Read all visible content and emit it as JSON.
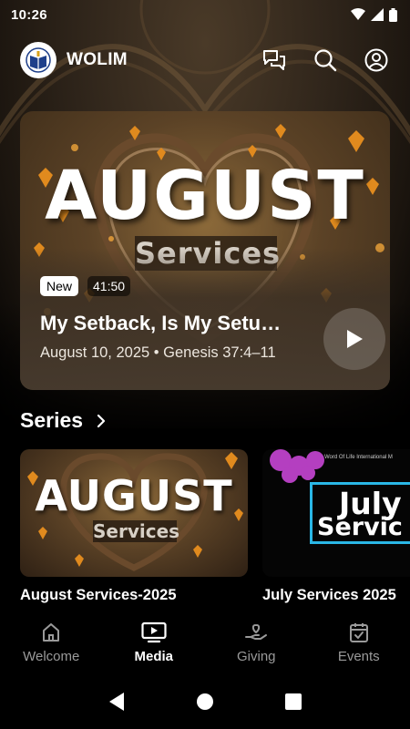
{
  "status_bar": {
    "time": "10:26"
  },
  "header": {
    "app_name": "WOLIM"
  },
  "hero": {
    "art_title": "AUGUST",
    "art_subtitle": "Services",
    "badge_new": "New",
    "duration": "41:50",
    "title": "My Setback, Is My Setu…",
    "meta": "August 10, 2025 • Genesis 37:4–11"
  },
  "series": {
    "title": "Series",
    "cards": [
      {
        "art_title": "AUGUST",
        "art_subtitle": "Services",
        "label": "August Services-2025"
      },
      {
        "art_caption": "Word Of Life International M",
        "art_line1": "July",
        "art_line2": "Servic",
        "label": "July Services 2025"
      }
    ]
  },
  "bottom_nav": {
    "items": [
      {
        "label": "Welcome",
        "icon": "home-icon"
      },
      {
        "label": "Media",
        "icon": "tv-icon",
        "active": true
      },
      {
        "label": "Giving",
        "icon": "hand-heart-icon"
      },
      {
        "label": "Events",
        "icon": "calendar-check-icon"
      }
    ]
  },
  "colors": {
    "accent_active": "#ffffff",
    "nav_inactive": "#9a9a9a",
    "july_frame": "#2ab7e6"
  }
}
